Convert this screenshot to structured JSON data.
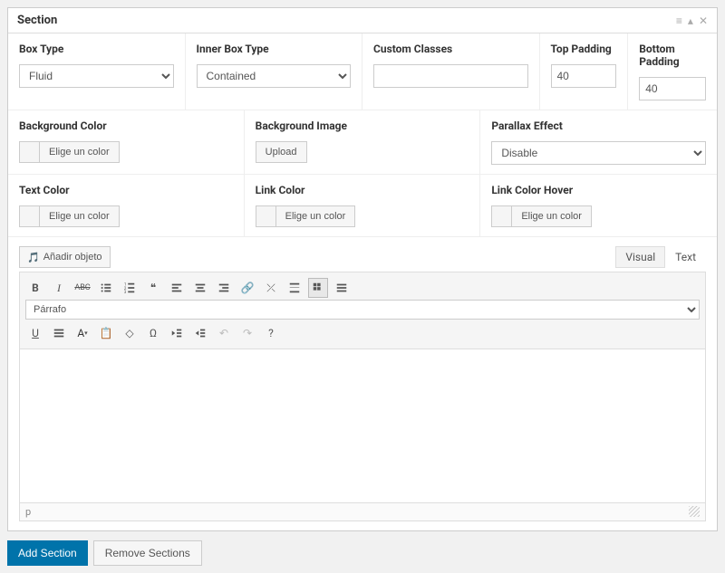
{
  "header": {
    "title": "Section"
  },
  "fields": {
    "box_type": {
      "label": "Box Type",
      "value": "Fluid"
    },
    "inner_box_type": {
      "label": "Inner Box Type",
      "value": "Contained"
    },
    "custom_classes": {
      "label": "Custom Classes",
      "value": ""
    },
    "top_padding": {
      "label": "Top Padding",
      "value": "40"
    },
    "bottom_padding": {
      "label": "Bottom Padding",
      "value": "40"
    },
    "bg_color": {
      "label": "Background Color",
      "button": "Elige un color"
    },
    "bg_image": {
      "label": "Background Image",
      "button": "Upload"
    },
    "parallax": {
      "label": "Parallax Effect",
      "value": "Disable"
    },
    "text_color": {
      "label": "Text Color",
      "button": "Elige un color"
    },
    "link_color": {
      "label": "Link Color",
      "button": "Elige un color"
    },
    "link_hover": {
      "label": "Link Color Hover",
      "button": "Elige un color"
    }
  },
  "editor": {
    "add_media": "Añadir objeto",
    "tab_visual": "Visual",
    "tab_text": "Text",
    "format_select": "Párrafo",
    "footer_path": "p"
  },
  "buttons": {
    "add_section": "Add Section",
    "remove_sections": "Remove Sections"
  },
  "toolbar": {
    "bold": "B",
    "italic": "I",
    "strike": "ABC",
    "quote": "❝",
    "letter_a": "A"
  }
}
